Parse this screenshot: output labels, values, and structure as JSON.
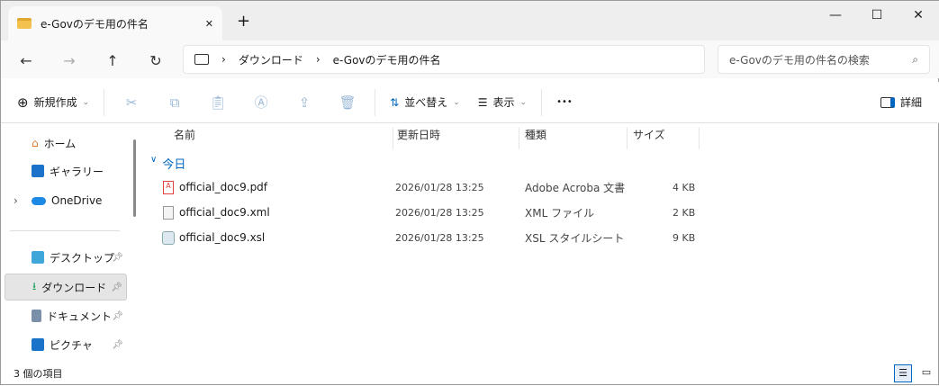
{
  "window": {
    "tab_title": "e-Govのデモ用の件名",
    "new_tab": "+",
    "minimize": "—",
    "maximize": "☐",
    "close": "✕",
    "tab_close": "✕"
  },
  "nav": {
    "back": "←",
    "forward": "→",
    "up": "↑",
    "refresh": "↻"
  },
  "address": {
    "crumbs": [
      "ダウンロード",
      "e-Govのデモ用の件名"
    ],
    "sep": "›"
  },
  "search": {
    "placeholder": "e-Govのデモ用の件名の検索"
  },
  "toolbar": {
    "new": "新規作成",
    "sort": "並べ替え",
    "view": "表示",
    "more": "•••",
    "details": "詳細"
  },
  "sidebar": {
    "items": [
      {
        "label": "ホーム"
      },
      {
        "label": "ギャラリー"
      },
      {
        "label": "OneDrive"
      },
      {
        "label": "デスクトップ"
      },
      {
        "label": "ダウンロード"
      },
      {
        "label": "ドキュメント"
      },
      {
        "label": "ピクチャ"
      }
    ]
  },
  "columns": [
    "名前",
    "更新日時",
    "種類",
    "サイズ"
  ],
  "group": "今日",
  "files": [
    {
      "name": "official_doc9.pdf",
      "date": "2026/01/28 13:25",
      "type": "Adobe Acroba 文書",
      "size": "4 KB"
    },
    {
      "name": "official_doc9.xml",
      "date": "2026/01/28 13:25",
      "type": "XML ファイル",
      "size": "2 KB"
    },
    {
      "name": "official_doc9.xsl",
      "date": "2026/01/28 13:25",
      "type": "XSL スタイルシート",
      "size": "9 KB"
    }
  ],
  "status": "3 個の項目",
  "colors": {
    "accent": "#0067c0",
    "selected": "#e5e5e5"
  }
}
